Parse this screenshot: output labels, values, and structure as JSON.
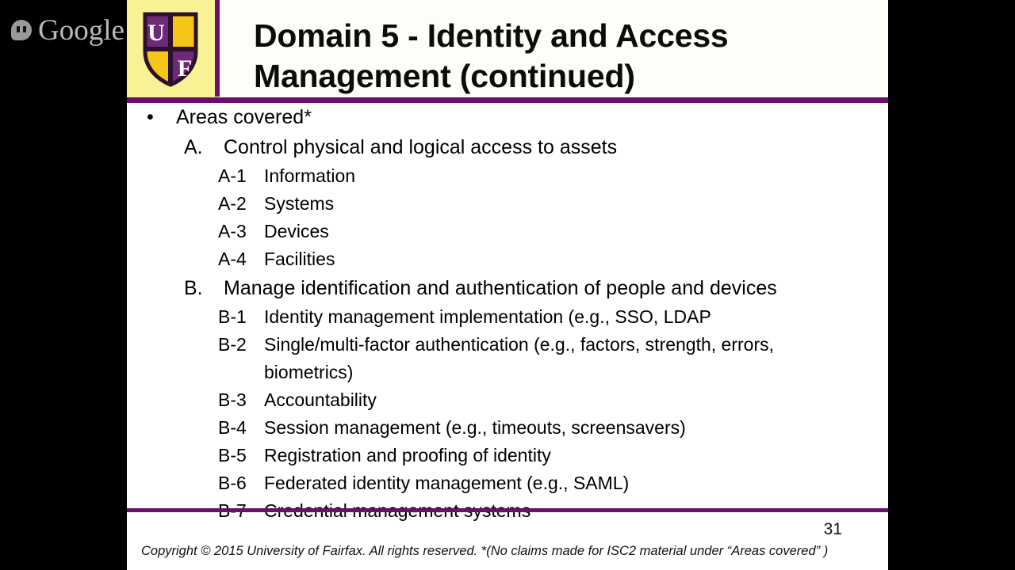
{
  "watermark": {
    "icon": "hangouts-icon",
    "label": "Google"
  },
  "slide": {
    "logo": {
      "icon": "uf-shield-logo",
      "letter_top": "U",
      "letter_bottom": "F"
    },
    "title": "Domain 5 - Identity and Access Management (continued)",
    "content": {
      "bullet_glyph": "•",
      "heading": "Areas covered*",
      "sections": [
        {
          "marker": "A.",
          "text": "Control physical and logical access to assets",
          "items": [
            {
              "marker": "A-1",
              "text": "Information"
            },
            {
              "marker": "A-2",
              "text": "Systems"
            },
            {
              "marker": "A-3",
              "text": "Devices"
            },
            {
              "marker": "A-4",
              "text": "Facilities"
            }
          ]
        },
        {
          "marker": "B.",
          "text": "Manage identification and authentication of people and devices",
          "items": [
            {
              "marker": "B-1",
              "text": "Identity management implementation (e.g., SSO, LDAP"
            },
            {
              "marker": "B-2",
              "text": "Single/multi-factor authentication (e.g., factors, strength, errors, biometrics)"
            },
            {
              "marker": "B-3",
              "text": "Accountability"
            },
            {
              "marker": "B-4",
              "text": "Session management (e.g., timeouts, screensavers)"
            },
            {
              "marker": "B-5",
              "text": "Registration and proofing of identity"
            },
            {
              "marker": "B-6",
              "text": "Federated identity management (e.g., SAML)"
            },
            {
              "marker": "B-7",
              "text": "Credential management systems"
            }
          ]
        }
      ]
    },
    "footer": {
      "page_number": "31",
      "copyright": "Copyright © 2015 University of Fairfax. All rights reserved.  *(No claims made for ISC2 material under “Areas covered” )"
    }
  },
  "colors": {
    "purple": "#6d0d6d",
    "gold": "#f5c518",
    "logo_bg": "#f7f294",
    "header_bg": "#fbfff8",
    "letterbox": "#000000"
  }
}
